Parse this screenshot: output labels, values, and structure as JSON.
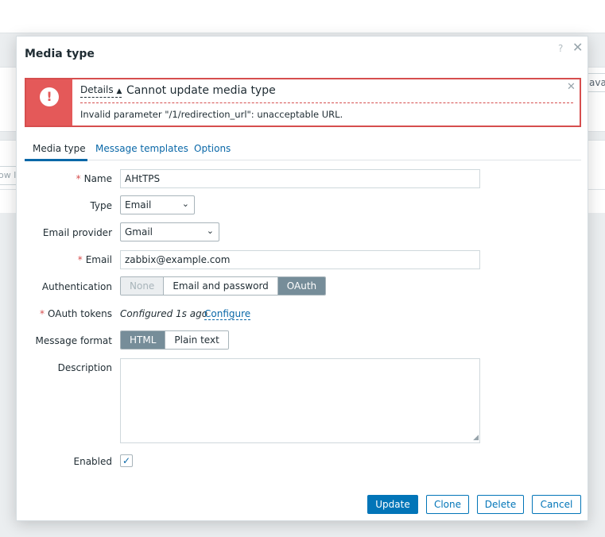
{
  "background": {
    "left_text": "ow le",
    "right_text": "ava"
  },
  "dialog": {
    "title": "Media type",
    "help_icon": "?",
    "close_icon": "✕"
  },
  "error": {
    "details_label": "Details",
    "details_arrow": "▲",
    "title": "Cannot update media type",
    "message": "Invalid parameter \"/1/redirection_url\": unacceptable URL.",
    "icon": "!",
    "close_icon": "✕",
    "colors": {
      "border": "#d64e4e",
      "icon_bg": "#e45959"
    }
  },
  "tabs": [
    {
      "label": "Media type",
      "active": true
    },
    {
      "label": "Message templates",
      "active": false
    },
    {
      "label": "Options",
      "active": false
    }
  ],
  "form": {
    "name": {
      "label": "Name",
      "required": "*",
      "value": "AHtTPS"
    },
    "type": {
      "label": "Type",
      "value": "Email"
    },
    "email_provider": {
      "label": "Email provider",
      "value": "Gmail"
    },
    "email": {
      "label": "Email",
      "required": "*",
      "value": "zabbix@example.com"
    },
    "authentication": {
      "label": "Authentication",
      "options": [
        "None",
        "Email and password",
        "OAuth"
      ],
      "selected": "OAuth"
    },
    "oauth_tokens": {
      "label": "OAuth tokens",
      "required": "*",
      "status": "Configured 1s ago",
      "link": "Configure"
    },
    "message_format": {
      "label": "Message format",
      "options": [
        "HTML",
        "Plain text"
      ],
      "selected": "HTML"
    },
    "description": {
      "label": "Description",
      "value": "",
      "resize_icon": "◢"
    },
    "enabled": {
      "label": "Enabled",
      "checked": true,
      "check_glyph": "✓"
    }
  },
  "buttons": {
    "update": "Update",
    "clone": "Clone",
    "delete": "Delete",
    "cancel": "Cancel"
  },
  "colors": {
    "accent": "#0275b8",
    "link": "#0a68a8",
    "toggle_on": "#768d99"
  },
  "icons": {
    "select_chevron": "⌄"
  }
}
